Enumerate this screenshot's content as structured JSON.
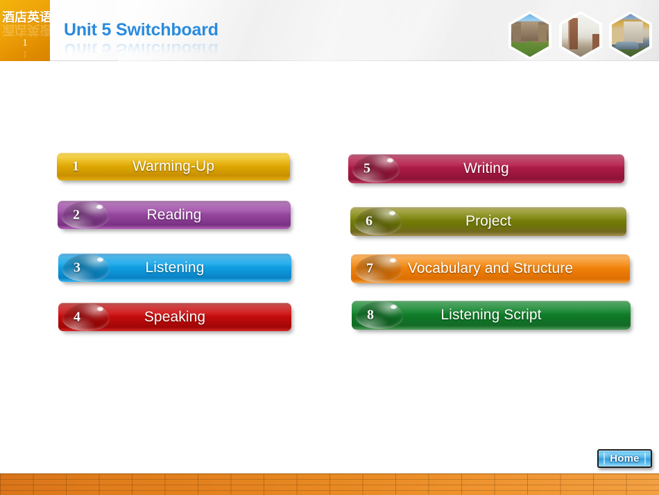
{
  "header": {
    "logo_text": "酒店英语",
    "logo_number": "1",
    "title": "Unit 5 Switchboard",
    "thumbnails": [
      {
        "name": "abbey-photo",
        "alt": "stone abbey building on lawn"
      },
      {
        "name": "ruin-photo",
        "alt": "brick ruin tower building"
      },
      {
        "name": "facade-photo",
        "alt": "ornate building facade with car"
      }
    ]
  },
  "switchboard": {
    "left_column": [
      {
        "number": "1",
        "label": "Warming-Up",
        "color": "#e0aa09",
        "variant": "c-gold",
        "orb": false
      },
      {
        "number": "2",
        "label": "Reading",
        "color": "#9b4aa3",
        "variant": "c-purple",
        "orb": true
      },
      {
        "number": "3",
        "label": "Listening",
        "color": "#16a8ec",
        "variant": "c-blue",
        "orb": true
      },
      {
        "number": "4",
        "label": "Speaking",
        "color": "#c00b0b",
        "variant": "c-red",
        "orb": true
      }
    ],
    "right_column": [
      {
        "number": "5",
        "label": "Writing",
        "color": "#ad1a46",
        "variant": "c-crimson",
        "orb": true
      },
      {
        "number": "6",
        "label": "Project",
        "color": "#7e8509",
        "variant": "c-olive",
        "orb": true
      },
      {
        "number": "7",
        "label": "Vocabulary and Structure",
        "color": "#f58a12",
        "variant": "c-orange",
        "orb": true
      },
      {
        "number": "8",
        "label": "Listening Script",
        "color": "#12852c",
        "variant": "c-green",
        "orb": true
      }
    ]
  },
  "footer": {
    "home_label": "Home",
    "bar_color": "#e3821f"
  }
}
